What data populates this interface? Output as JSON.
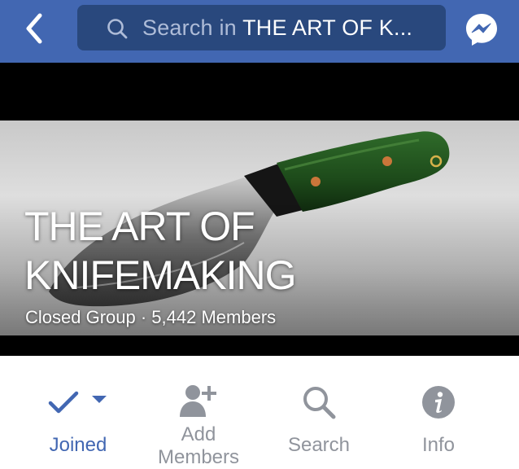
{
  "navbar": {
    "search_prefix": "Search in ",
    "search_group": "THE ART OF K..."
  },
  "cover": {
    "title": "THE ART OF KNIFEMAKING",
    "subtitle": "Closed Group · 5,442 Members"
  },
  "actions": {
    "joined_label": "Joined",
    "add_members_label": "Add Members",
    "search_label": "Search",
    "info_label": "Info"
  },
  "colors": {
    "nav_bg": "#4267b2",
    "search_bg": "#29487d",
    "accent": "#4267b2",
    "inactive": "#90949c"
  },
  "icons": {
    "back": "chevron-left-icon",
    "search": "magnifier-icon",
    "messenger": "messenger-icon",
    "joined": "checkmark-icon",
    "dropdown": "caret-down-icon",
    "add_members": "add-person-icon",
    "info": "info-icon"
  }
}
